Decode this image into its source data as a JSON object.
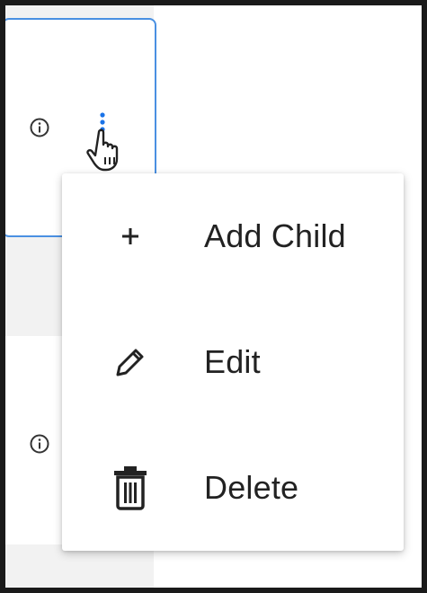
{
  "menu": {
    "items": [
      {
        "label": "Add Child",
        "icon": "plus-icon"
      },
      {
        "label": "Edit",
        "icon": "pencil-icon"
      },
      {
        "label": "Delete",
        "icon": "trash-icon"
      }
    ]
  },
  "colors": {
    "selection_border": "#4a90e2",
    "kebab_dot": "#1a73e8",
    "text": "#222222",
    "frame": "#1a1a1a"
  },
  "icons": {
    "info": "info-icon",
    "more": "more-vertical-icon",
    "cursor": "hand-pointer-cursor"
  }
}
